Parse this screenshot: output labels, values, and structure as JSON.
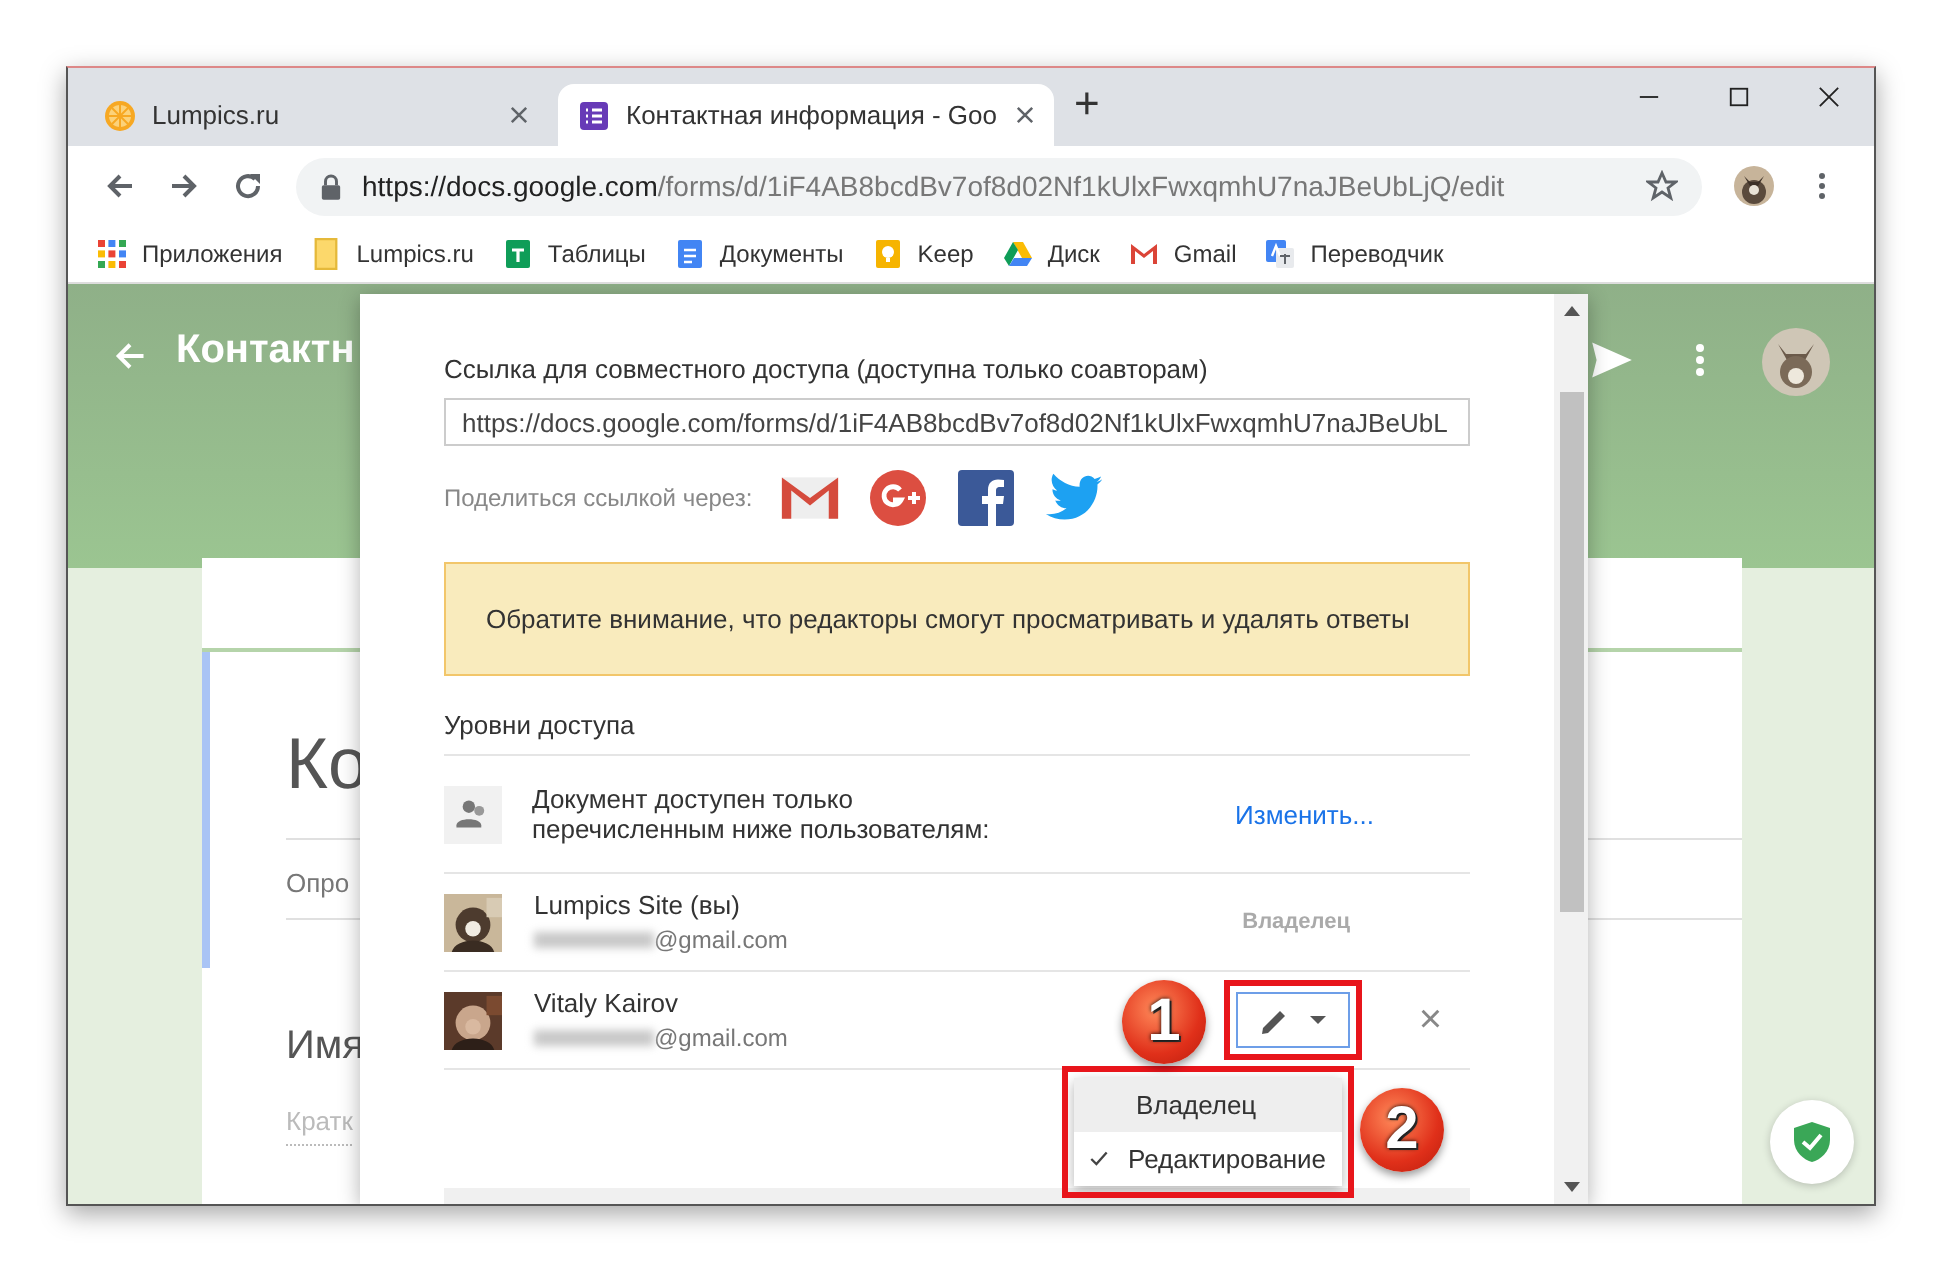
{
  "browser": {
    "tabs": [
      {
        "title": "Lumpics.ru",
        "kind": "site",
        "selected": false
      },
      {
        "title": "Контактная информация - Goo",
        "kind": "forms",
        "selected": true
      }
    ],
    "url": {
      "host": "https://docs.google.com",
      "path": "/forms/d/1iF4AB8bcdBv7of8d02Nf1kUlxFwxqmhU7naJBeUbLjQ/edit"
    },
    "new_tab": "+",
    "bookmarks": [
      {
        "label": "Приложения",
        "kind": "apps"
      },
      {
        "label": "Lumpics.ru",
        "kind": "folder"
      },
      {
        "label": "Таблицы",
        "kind": "sheets"
      },
      {
        "label": "Документы",
        "kind": "docs"
      },
      {
        "label": "Keep",
        "kind": "keep"
      },
      {
        "label": "Диск",
        "kind": "drive"
      },
      {
        "label": "Gmail",
        "kind": "gmail"
      },
      {
        "label": "Переводчик",
        "kind": "translate"
      }
    ]
  },
  "form": {
    "title": "Контактн",
    "heading": "Ко",
    "description": "Опро",
    "question": "Имя",
    "answer_placeholder": "Кратк"
  },
  "dialog": {
    "link_label": "Ссылка для совместного доступа (доступна только соавторам)",
    "link_value": "https://docs.google.com/forms/d/1iF4AB8bcdBv7of8d02Nf1kUlxFwxqmhU7naJBeUbL",
    "share_label": "Поделиться ссылкой через:",
    "notice": "Обратите внимание, что редакторы смогут просматривать и удалять ответы",
    "access_heading": "Уровни доступа",
    "access_text": "Документ доступен только перечисленным ниже пользователям:",
    "change_link": "Изменить...",
    "people": [
      {
        "name": "Lumpics Site (вы)",
        "email": "@gmail.com",
        "kind": "owner",
        "role": "Владелец"
      },
      {
        "name": "Vitaly Kairov",
        "email": "@gmail.com",
        "kind": "editor",
        "remove": "×"
      }
    ],
    "role_menu": [
      {
        "label": "Владелец",
        "hovered": true,
        "selected": false
      },
      {
        "label": "Редактирование",
        "hovered": false,
        "selected": true
      }
    ]
  },
  "callouts": [
    "1",
    "2"
  ]
}
